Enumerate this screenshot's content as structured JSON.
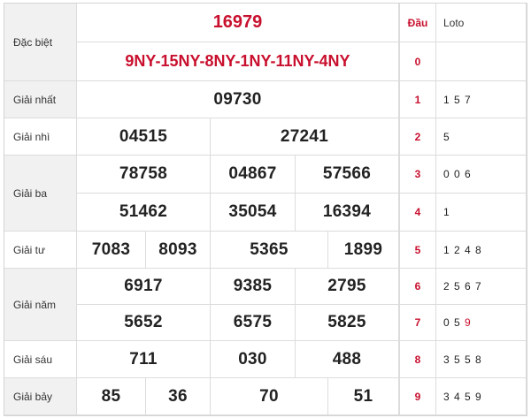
{
  "labels": {
    "special": "Đặc biệt",
    "first": "Giải nhất",
    "second": "Giải nhì",
    "third": "Giải ba",
    "fourth": "Giải tư",
    "fifth": "Giải năm",
    "sixth": "Giải sáu",
    "seventh": "Giải bảy"
  },
  "special": {
    "number": "16979",
    "codes": "9NY-15NY-8NY-1NY-11NY-4NY"
  },
  "first": [
    "09730"
  ],
  "second": [
    "04515",
    "27241"
  ],
  "third": [
    "78758",
    "04867",
    "57566",
    "51462",
    "35054",
    "16394"
  ],
  "fourth": [
    "7083",
    "8093",
    "5365",
    "1899"
  ],
  "fifth": [
    "6917",
    "9385",
    "2795",
    "5652",
    "6575",
    "5825"
  ],
  "sixth": [
    "711",
    "030",
    "488"
  ],
  "seventh": [
    "85",
    "36",
    "70",
    "51"
  ],
  "loto_table": {
    "head_label": "Đầu",
    "loto_label": "Loto",
    "rows": [
      {
        "head": "0",
        "tails": ""
      },
      {
        "head": "1",
        "tails": "1 5 7"
      },
      {
        "head": "2",
        "tails": "5"
      },
      {
        "head": "3",
        "tails": "0 0 6"
      },
      {
        "head": "4",
        "tails": "1"
      },
      {
        "head": "5",
        "tails": "1 2 4 8"
      },
      {
        "head": "6",
        "tails": "2 5 6 7"
      },
      {
        "head": "7",
        "tails_plain": "0 5",
        "tails_highlight": "9"
      },
      {
        "head": "8",
        "tails": "3 5 5 8"
      },
      {
        "head": "9",
        "tails": "3 4 5 9"
      }
    ]
  },
  "colors": {
    "accent": "#c8102e",
    "label_bg": "#f1f1f1",
    "border": "#dcdcdc"
  }
}
